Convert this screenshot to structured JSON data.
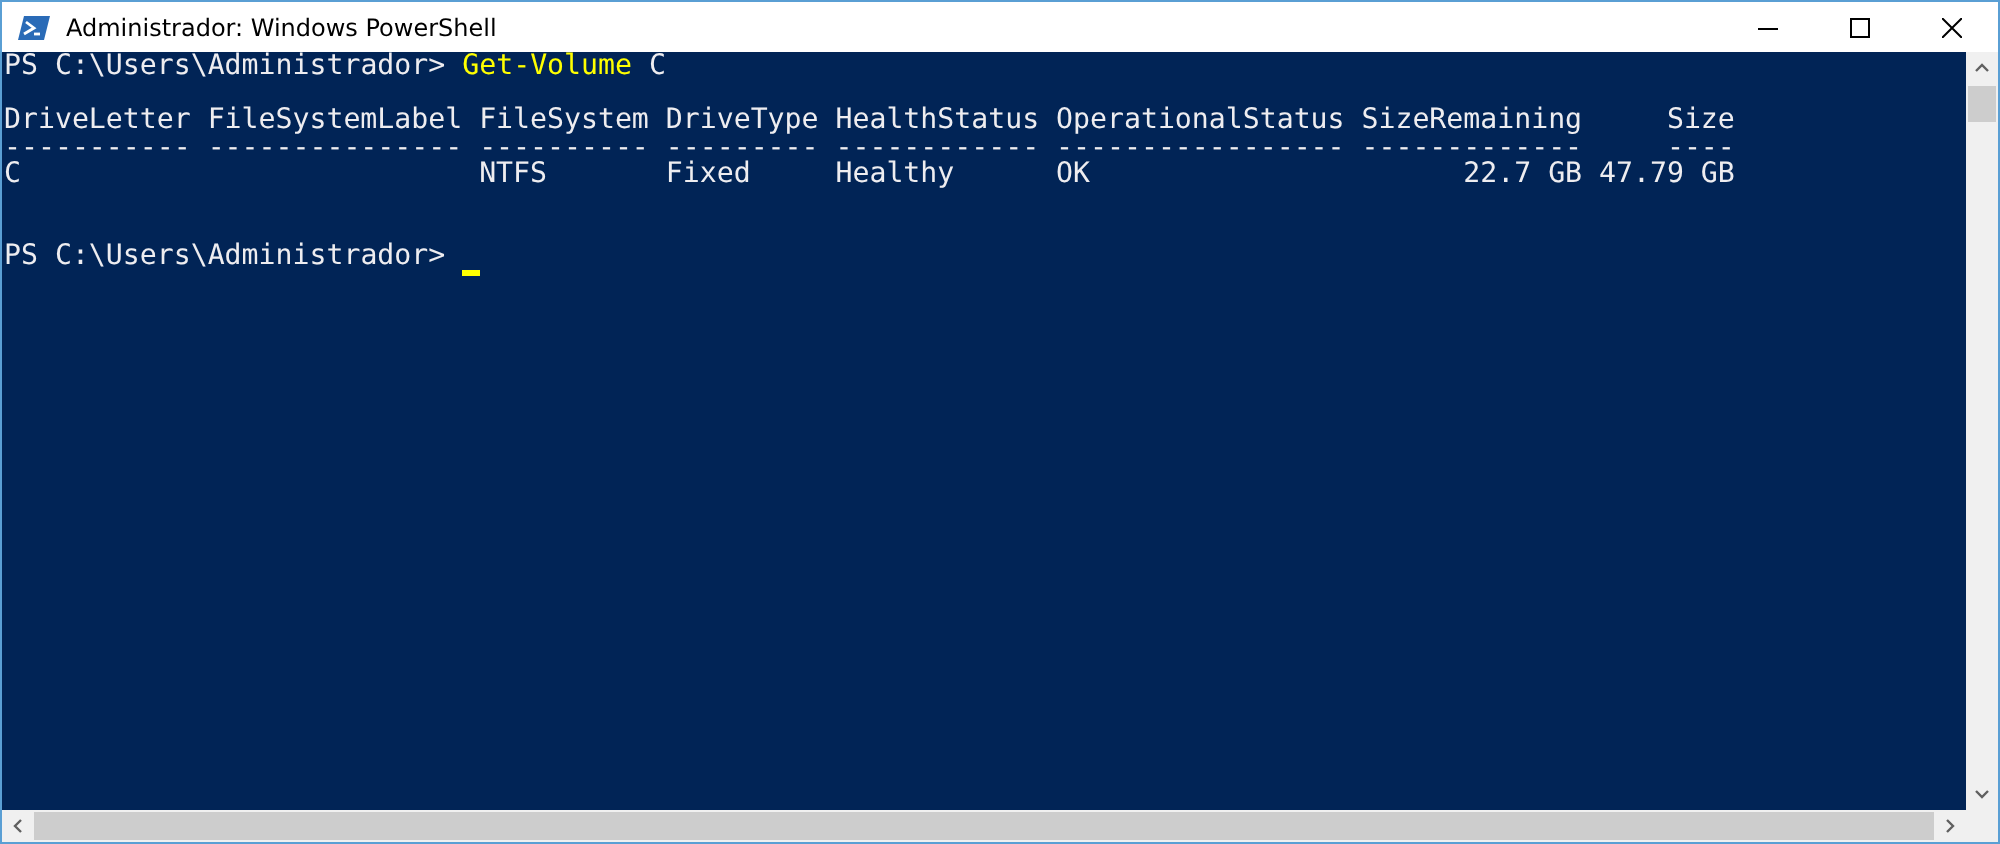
{
  "window": {
    "title": "Administrador: Windows PowerShell"
  },
  "console": [
    {
      "kind": "prompt",
      "prompt": "PS C:\\Users\\Administrador>",
      "command": [
        {
          "kind": "cmdlet",
          "text": "Get-Volume"
        },
        {
          "kind": "argument",
          "text": "C"
        }
      ]
    },
    {
      "kind": "blank"
    },
    {
      "kind": "table",
      "columns": [
        {
          "header": "DriveLetter",
          "rule": "-----------",
          "numeric": false,
          "cells": [
            "C"
          ]
        },
        {
          "header": "FileSystemLabel",
          "rule": "---------------",
          "numeric": false
        },
        {
          "header": "FileSystem",
          "rule": "----------",
          "numeric": false,
          "cells": [
            "NTFS"
          ]
        },
        {
          "header": "DriveType",
          "rule": "---------",
          "numeric": false,
          "cells": [
            "Fixed"
          ]
        },
        {
          "header": "HealthStatus",
          "rule": "------------",
          "numeric": false,
          "cells": [
            "Healthy"
          ]
        },
        {
          "header": "OperationalStatus",
          "rule": "-----------------",
          "numeric": false,
          "cells": [
            "OK"
          ]
        },
        {
          "header": "SizeRemaining",
          "rule": "-------------",
          "numeric": true,
          "cells": [
            "22.7 GB"
          ]
        },
        {
          "header": "Size",
          "rule": "----",
          "numeric": true,
          "cells": [
            "47.79 GB"
          ]
        }
      ]
    },
    {
      "kind": "blank"
    },
    {
      "kind": "blank"
    },
    {
      "kind": "prompt",
      "prompt": "PS C:\\Users\\Administrador>",
      "cursor": true
    }
  ]
}
